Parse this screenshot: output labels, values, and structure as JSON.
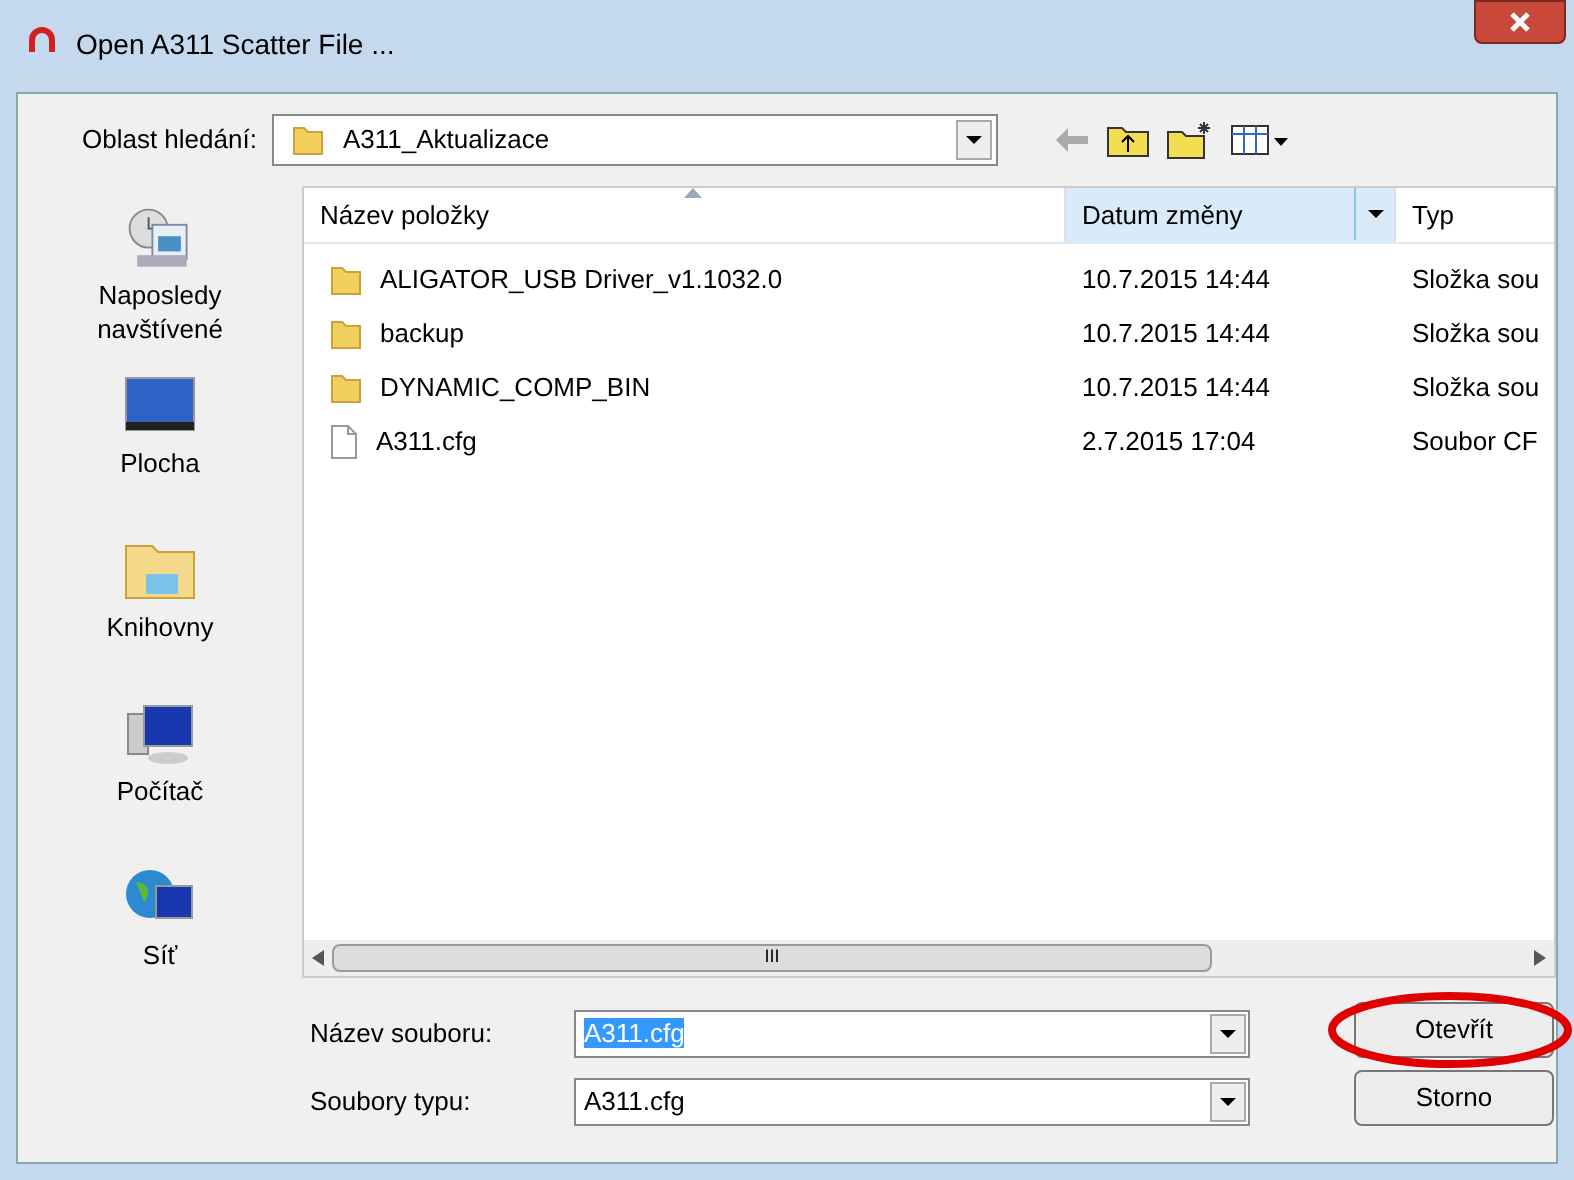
{
  "window": {
    "title": "Open A311 Scatter File ..."
  },
  "location": {
    "label": "Oblast hledání:",
    "value": "A311_Aktualizace"
  },
  "places": [
    {
      "kind": "recent",
      "label": "Naposledy navštívené"
    },
    {
      "kind": "desktop",
      "label": "Plocha"
    },
    {
      "kind": "libraries",
      "label": "Knihovny"
    },
    {
      "kind": "computer",
      "label": "Počítač"
    },
    {
      "kind": "network",
      "label": "Síť"
    }
  ],
  "table": {
    "columns": [
      {
        "label": "Název položky",
        "sorted": true,
        "highlighted": false
      },
      {
        "label": "Datum změny",
        "sorted": false,
        "highlighted": true
      },
      {
        "label": "Typ",
        "sorted": false,
        "highlighted": false
      }
    ],
    "rows": [
      {
        "kind": "folder",
        "name": "ALIGATOR_USB Driver_v1.1032.0",
        "date": "10.7.2015 14:44",
        "type": "Složka sou"
      },
      {
        "kind": "folder",
        "name": "backup",
        "date": "10.7.2015 14:44",
        "type": "Složka sou"
      },
      {
        "kind": "folder",
        "name": "DYNAMIC_COMP_BIN",
        "date": "10.7.2015 14:44",
        "type": "Složka sou"
      },
      {
        "kind": "file",
        "name": "A311.cfg",
        "date": "2.7.2015 17:04",
        "type": "Soubor CF"
      }
    ]
  },
  "scrollbar_grip": "III",
  "file_name": {
    "label": "Název souboru:",
    "value": "A311.cfg",
    "selected": true
  },
  "file_type": {
    "label": "Soubory typu:",
    "value": "A311.cfg"
  },
  "buttons": [
    {
      "label": "Otevřít",
      "circled": true
    },
    {
      "label": "Storno",
      "circled": false
    }
  ]
}
